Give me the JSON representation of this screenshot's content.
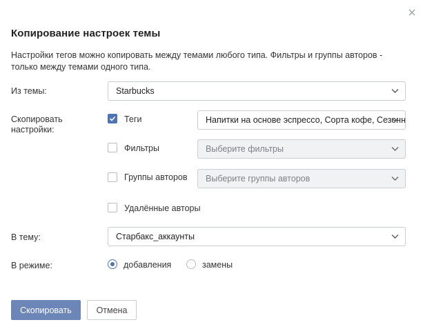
{
  "dialog": {
    "title": "Копирование настроек темы",
    "description": "Настройки тегов можно копировать между темами любого типа. Фильтры и группы авторов - только между темами одного типа.",
    "close_icon": "close-icon"
  },
  "source": {
    "label": "Из темы:",
    "value": "Starbucks"
  },
  "copy_settings": {
    "label": "Скопировать настройки:",
    "tags": {
      "label": "Теги",
      "checked": true,
      "value": "Напитки на основе эспрессо, Сорта кофе, Сезонное"
    },
    "filters": {
      "label": "Фильтры",
      "checked": false,
      "placeholder": "Выберите фильтры"
    },
    "author_groups": {
      "label": "Группы авторов",
      "checked": false,
      "placeholder": "Выберите группы авторов"
    },
    "deleted_authors": {
      "label": "Удалённые авторы",
      "checked": false
    }
  },
  "target": {
    "label": "В тему:",
    "value": "Старбакс_аккаунты"
  },
  "mode": {
    "label": "В режиме:",
    "options": [
      {
        "label": "добавления",
        "selected": true
      },
      {
        "label": "замены",
        "selected": false
      }
    ]
  },
  "buttons": {
    "copy": "Скопировать",
    "cancel": "Отмена"
  },
  "colors": {
    "accent": "#4f73b3",
    "primary_button": "#6c86b8",
    "border": "#c9ccd1",
    "disabled_bg": "#f1f2f4"
  }
}
